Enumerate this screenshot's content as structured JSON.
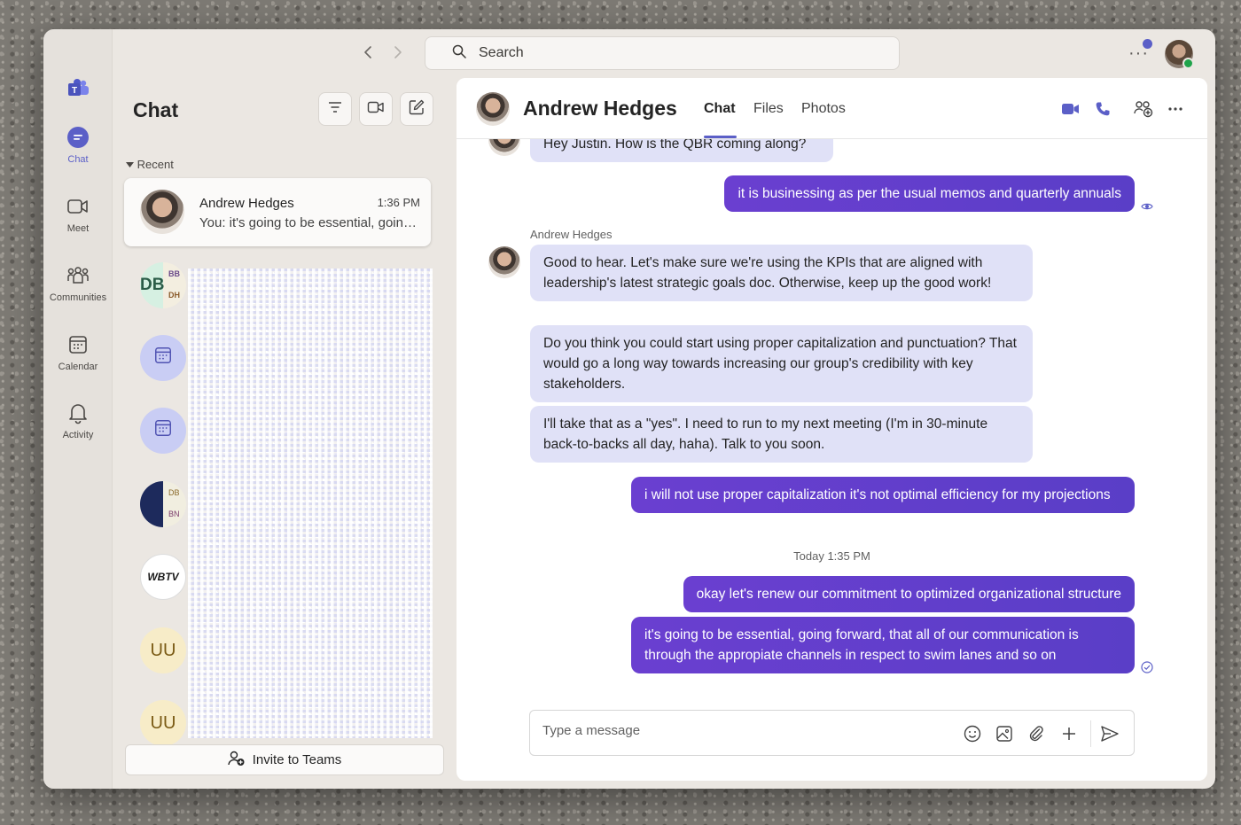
{
  "window": {
    "search_placeholder": "Search",
    "more_label": "···"
  },
  "rail": {
    "items": [
      {
        "label": "Chat",
        "icon": "chat-icon"
      },
      {
        "label": "Meet",
        "icon": "video-icon"
      },
      {
        "label": "Communities",
        "icon": "communities-icon"
      },
      {
        "label": "Calendar",
        "icon": "calendar-icon"
      },
      {
        "label": "Activity",
        "icon": "bell-icon"
      }
    ],
    "accent": "#5b5fc7"
  },
  "chat_list": {
    "title": "Chat",
    "section_label": "Recent",
    "recent": {
      "name": "Andrew Hedges",
      "time": "1:36 PM",
      "preview": "You: it's going to be essential, going forward, that all of our communication is through the appropiate channels"
    },
    "avatars": [
      {
        "initials": "DB",
        "sub": [
          "BB",
          "DH"
        ]
      },
      {
        "icon": "calendar-icon"
      },
      {
        "icon": "calendar-icon"
      },
      {
        "sub": [
          "DB",
          "BN"
        ]
      },
      {
        "initials": "WBTV"
      },
      {
        "initials": "UU"
      },
      {
        "initials": "UU"
      }
    ],
    "invite_label": "Invite to Teams"
  },
  "conversation": {
    "contact_name": "Andrew Hedges",
    "tabs": [
      "Chat",
      "Files",
      "Photos"
    ],
    "active_tab": "Chat",
    "messages": {
      "m1": "Hey Justin. How is the QBR coming along?",
      "m2": "it is businessing as per the usual memos and quarterly annuals",
      "sender": "Andrew Hedges",
      "m3": "Good to hear. Let's make sure we're using the KPIs that are aligned with leadership's latest strategic goals doc. Otherwise, keep up the good work!",
      "m4": "Do you think you could start using proper capitalization and punctuation? That would go a long way towards increasing our group's credibility with key stakeholders.",
      "m5": "I'll take that as a \"yes\". I need to run to my next meeting (I'm in 30-minute back-to-backs all day, haha). Talk to you soon.",
      "m6": "i will not use proper capitalization it's not optimal efficiency for my projections",
      "separator": "Today 1:35 PM",
      "m7": "okay let's renew our commitment to optimized organizational structure",
      "m8": "it's going to be essential, going forward, that all of our communication is through the appropiate channels in respect to swim lanes and so on"
    },
    "composer_placeholder": "Type a message",
    "outgoing_color": "#6a3fd0",
    "incoming_color": "#e0e1f7"
  }
}
